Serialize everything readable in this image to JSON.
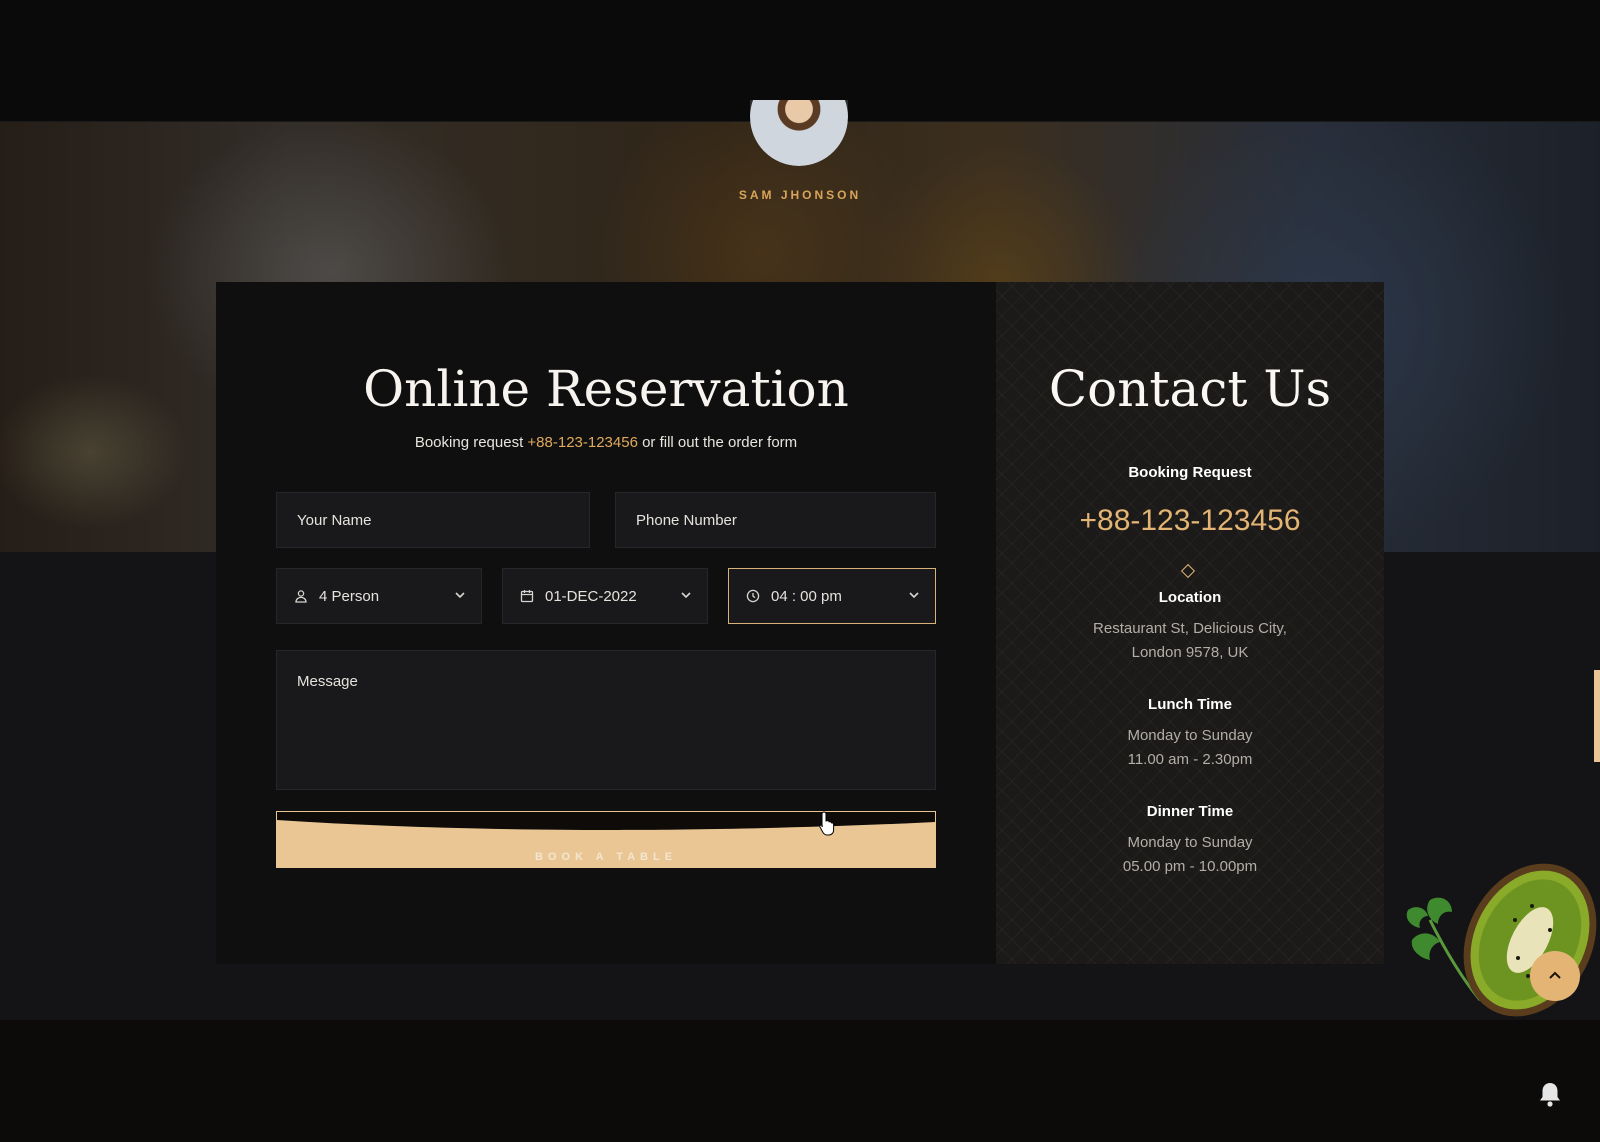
{
  "testimonial": {
    "author": "SAM JHONSON"
  },
  "reservation": {
    "title": "Online Reservation",
    "subtitle_prefix": "Booking request",
    "phone": "+88-123-123456",
    "subtitle_suffix": "or fill out the order form",
    "name_placeholder": "Your Name",
    "phone_placeholder": "Phone Number",
    "person_value": "4 Person",
    "date_value": "01-DEC-2022",
    "time_value": "04 : 00 pm",
    "message_placeholder": "Message",
    "button_label": "BOOK A TABLE"
  },
  "contact": {
    "title": "Contact Us",
    "booking_heading": "Booking Request",
    "booking_phone": "+88-123-123456",
    "location_heading": "Location",
    "location_line1": "Restaurant St, Delicious City,",
    "location_line2": "London 9578, UK",
    "lunch_heading": "Lunch Time",
    "lunch_days": "Monday to Sunday",
    "lunch_hours": "11.00 am - 2.30pm",
    "dinner_heading": "Dinner Time",
    "dinner_days": "Monday to Sunday",
    "dinner_hours": "05.00 pm - 10.00pm"
  },
  "colors": {
    "accent": "#e3b474",
    "button": "#e9c693",
    "card": "#0f0f10"
  },
  "icons": [
    "person-icon",
    "calendar-icon",
    "clock-icon",
    "chevron-down-icon",
    "chevron-up-icon",
    "bell-icon",
    "diamond-icon"
  ]
}
